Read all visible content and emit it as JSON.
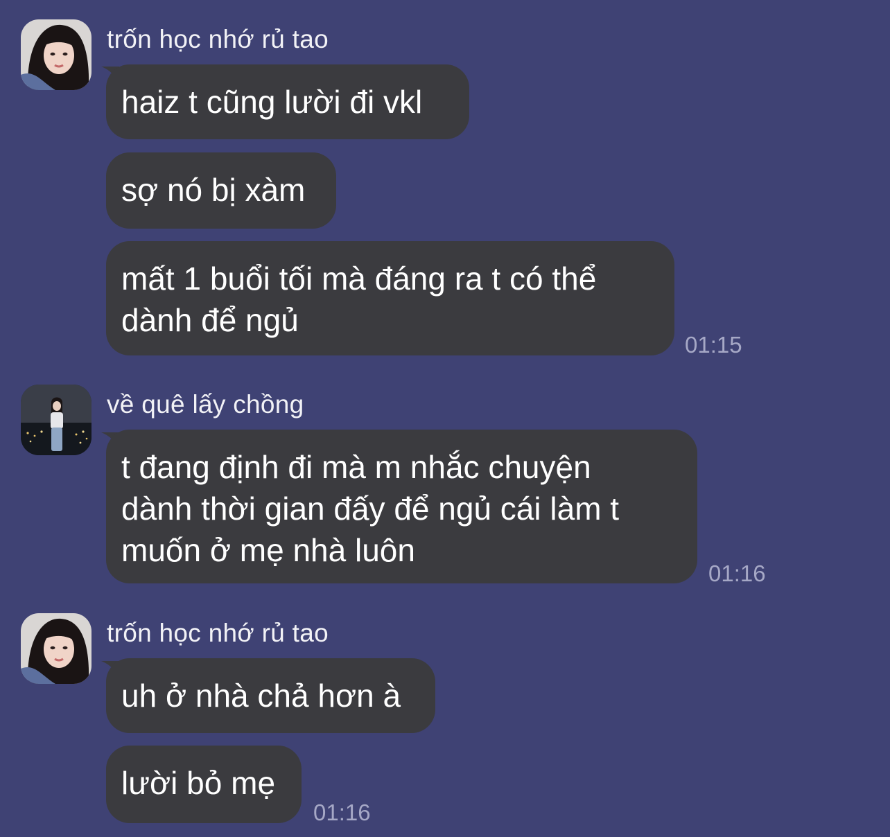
{
  "chat": {
    "groups": [
      {
        "sender": "trốn học nhớ rủ tao",
        "messages": [
          {
            "text": "haiz t cũng lười đi vkl"
          },
          {
            "text": "sợ nó bị xàm"
          },
          {
            "lines": [
              "mất 1 buổi tối mà đáng ra t có thể",
              "dành để ngủ"
            ],
            "time": "01:15"
          }
        ]
      },
      {
        "sender": "về quê lấy chồng",
        "messages": [
          {
            "lines": [
              "t đang định đi mà m nhắc chuyện",
              "dành thời gian đấy để ngủ cái làm t",
              "muốn ở mẹ nhà luôn"
            ],
            "time": "01:16"
          }
        ]
      },
      {
        "sender": "trốn học nhớ rủ tao",
        "messages": [
          {
            "text": "uh ở nhà chả hơn à"
          },
          {
            "text": "lười bỏ mẹ",
            "time": "01:16"
          }
        ]
      }
    ]
  },
  "colors": {
    "background": "#3f4274",
    "bubble": "#3b3b3f",
    "text": "#ffffff",
    "timestamp": "#a6a8c6"
  }
}
